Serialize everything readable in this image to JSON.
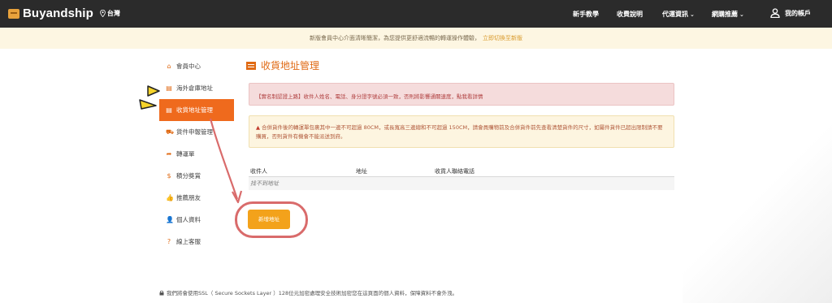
{
  "header": {
    "logo": "Buyandship",
    "region": "台灣",
    "nav": [
      {
        "label": "新手教學"
      },
      {
        "label": "收費說明"
      },
      {
        "label": "代運資訊"
      },
      {
        "label": "網購推薦"
      }
    ],
    "account": "我的帳戶"
  },
  "banner": {
    "text": "新版會員中心介面清晰簡潔，為您提供更舒適流暢的轉運操作體驗，",
    "link": "立即切換至新版"
  },
  "sidebar": {
    "items": [
      {
        "label": "會員中心",
        "icon": "home-icon",
        "glyph": "⌂"
      },
      {
        "label": "海外倉庫地址",
        "icon": "address-card-icon",
        "glyph": "▤"
      },
      {
        "label": "收貨地址管理",
        "icon": "address-card-icon",
        "glyph": "▤"
      },
      {
        "label": "貨件申報管理",
        "icon": "cart-icon",
        "glyph": "⛟"
      },
      {
        "label": "轉運單",
        "icon": "share-icon",
        "glyph": "➦"
      },
      {
        "label": "積分獎賞",
        "icon": "dollar-icon",
        "glyph": "$"
      },
      {
        "label": "推薦朋友",
        "icon": "thumbs-up-icon",
        "glyph": "👍"
      },
      {
        "label": "個人資料",
        "icon": "user-icon",
        "glyph": "👤"
      },
      {
        "label": "線上客服",
        "icon": "help-icon",
        "glyph": "?"
      }
    ]
  },
  "main": {
    "title": "收貨地址管理",
    "alert_red": {
      "text": "【實名制認證上路】收件人姓名、電話、身分證字號必須一致，否則將影響通關速度，",
      "link": "點我看詳情"
    },
    "alert_yellow": "合併貨件後的轉運單包裹其中一邊不可超過 80CM，或長寬高三邊總和不可超過 150CM，請會員購物前及合併貨件前先查看清楚貨件的尺寸，如屬件貨件已超出限制請不要購買，否則貨件有機會不能派送到府。",
    "table": {
      "headers": [
        "收件人",
        "地址",
        "收貨人聯絡電話"
      ],
      "empty": "找不到地址"
    },
    "add_button": "新增地址"
  },
  "footer": {
    "text": "我們將會使用SSL（ Secure Sockets Layer ）128位元加密處理安全技術加密您在這頁面的個人資料，保障資料不會外洩。"
  },
  "colors": {
    "accent": "#ef6a1d",
    "button": "#f3a21b",
    "annotation": "#d96b6b",
    "arrow_yellow": "#f5d32a"
  }
}
